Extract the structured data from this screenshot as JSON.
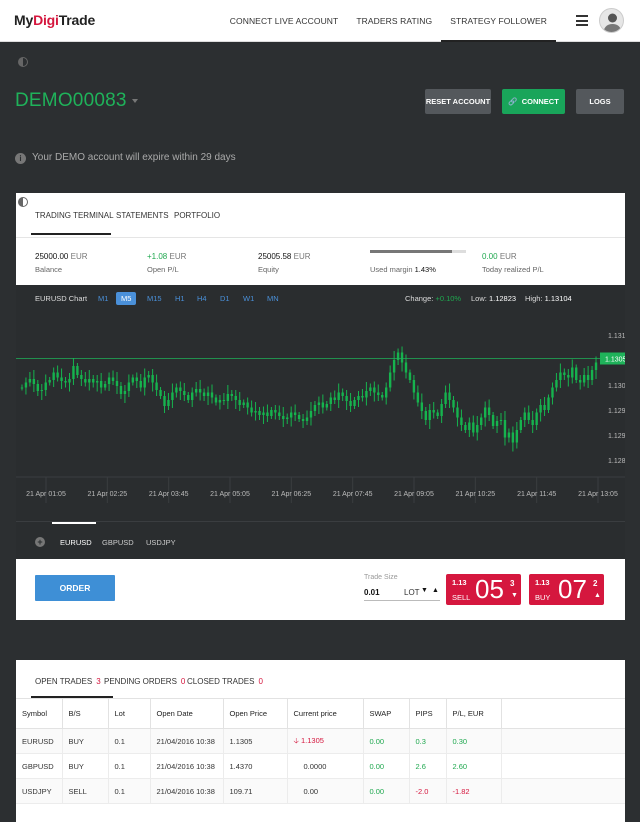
{
  "brand": {
    "logo_pre": "My",
    "logo_mid": "Digi",
    "logo_post": "Trade"
  },
  "nav": {
    "items": [
      "CONNECT LIVE ACCOUNT",
      "TRADERS RATING",
      "STRATEGY FOLLOWER"
    ],
    "active": "STRATEGY FOLLOWER"
  },
  "account": {
    "name": "DEMO00083",
    "expiry_notice": "Your DEMO account will expire within 29 days"
  },
  "actions": {
    "reset": "RESET ACCOUNT",
    "connect": "CONNECT",
    "logs": "LOGS"
  },
  "terminal_tabs": [
    "TRADING TERMINAL",
    "STATEMENTS",
    "PORTFOLIO"
  ],
  "stats": {
    "balance": {
      "value": "25000.00",
      "unit": "EUR",
      "label": "Balance"
    },
    "open_pl": {
      "value": "+1.08",
      "unit": "EUR",
      "label": "Open P/L"
    },
    "equity": {
      "value": "25005.58",
      "unit": "EUR",
      "label": "Equity"
    },
    "used_margin": {
      "label": "Used margin",
      "value": "1.43%",
      "fill": 0.85
    },
    "today_pl": {
      "value": "0.00",
      "unit": "EUR",
      "label": "Today realized P/L"
    }
  },
  "chart_header": {
    "title": "EURUSD Chart",
    "timeframes": [
      "M1",
      "M5",
      "M15",
      "H1",
      "H4",
      "D1",
      "W1",
      "MN"
    ],
    "active_timeframe": "M5",
    "change_label": "Change:",
    "change_value": "+0.10%",
    "low_label": "Low:",
    "low_value": "1.12823",
    "high_label": "High:",
    "high_value": "1.13104"
  },
  "chart_data": {
    "type": "candlestick",
    "symbol": "EURUSD",
    "y_ticks": [
      1.131,
      1.1305,
      1.13,
      1.1295,
      1.129,
      1.1285
    ],
    "y_tick_labels": [
      "1.13100",
      "1.13050",
      "1.13000",
      "1.12950",
      "1.12900",
      "1.12850"
    ],
    "ylim": [
      1.1281,
      1.1312
    ],
    "x_tick_labels": [
      "21 Apr 01:05",
      "21 Apr 02:25",
      "21 Apr 03:45",
      "21 Apr 05:05",
      "21 Apr 06:25",
      "21 Apr 07:45",
      "21 Apr 09:05",
      "21 Apr 10:25",
      "21 Apr 11:45",
      "21 Apr 13:05"
    ],
    "current_price": 1.13053,
    "current_price_label": "1.13053",
    "candles_close": [
      1.12995,
      1.13005,
      1.13012,
      1.13002,
      1.12988,
      1.1299,
      1.13005,
      1.1301,
      1.13025,
      1.13015,
      1.13008,
      1.13005,
      1.13012,
      1.13038,
      1.1302,
      1.13012,
      1.13005,
      1.13012,
      1.13005,
      1.13008,
      1.12995,
      1.13002,
      1.13015,
      1.13008,
      1.12998,
      1.12982,
      1.12988,
      1.13005,
      1.13015,
      1.13008,
      1.12995,
      1.13015,
      1.1302,
      1.13005,
      1.1299,
      1.12978,
      1.12958,
      1.1297,
      1.12985,
      1.12995,
      1.12988,
      1.1298,
      1.1297,
      1.12985,
      1.12992,
      1.12985,
      1.12978,
      1.12985,
      1.12975,
      1.12965,
      1.1297,
      1.12968,
      1.12982,
      1.12978,
      1.1297,
      1.1296,
      1.12965,
      1.12955,
      1.12945,
      1.12948,
      1.1294,
      1.12945,
      1.12938,
      1.1295,
      1.12945,
      1.12938,
      1.12932,
      1.12935,
      1.12945,
      1.1294,
      1.12932,
      1.12928,
      1.12935,
      1.12948,
      1.1296,
      1.12965,
      1.12955,
      1.12962,
      1.12975,
      1.1297,
      1.12985,
      1.12978,
      1.12968,
      1.12958,
      1.1297,
      1.12978,
      1.12975,
      1.12988,
      1.12995,
      1.12985,
      1.1298,
      1.12975,
      1.12995,
      1.13025,
      1.1305,
      1.13065,
      1.13045,
      1.13025,
      1.1301,
      1.12985,
      1.12965,
      1.12948,
      1.1293,
      1.1295,
      1.12945,
      1.12938,
      1.12962,
      1.12985,
      1.1297,
      1.12955,
      1.12935,
      1.1292,
      1.1291,
      1.12925,
      1.12905,
      1.1292,
      1.12935,
      1.12955,
      1.1294,
      1.12918,
      1.12928,
      1.1293,
      1.12895,
      1.12905,
      1.12885,
      1.1291,
      1.1293,
      1.12945,
      1.1293,
      1.1292,
      1.12945,
      1.1296,
      1.1295,
      1.12975,
      1.12995,
      1.1301,
      1.13025,
      1.1302,
      1.13015,
      1.13035,
      1.1301,
      1.13005,
      1.1302,
      1.1301,
      1.1303,
      1.13045
    ]
  },
  "pairs": [
    "EURUSD",
    "GBPUSD",
    "USDJPY"
  ],
  "active_pair": "EURUSD",
  "order": {
    "button": "ORDER",
    "trade_size_label": "Trade Size",
    "trade_size_value": "0.01",
    "unit": "LOT",
    "sell": {
      "prefix": "1.13",
      "label": "SELL",
      "big": "05",
      "sup": "3"
    },
    "buy": {
      "prefix": "1.13",
      "label": "BUY",
      "big": "07",
      "sup": "2"
    }
  },
  "trade_tabs": [
    {
      "label": "OPEN TRADES",
      "count": "3"
    },
    {
      "label": "PENDING ORDERS",
      "count": "0"
    },
    {
      "label": "CLOSED TRADES",
      "count": "0"
    }
  ],
  "table": {
    "headers": [
      "Symbol",
      "B/S",
      "Lot",
      "Open Date",
      "Open Price",
      "Current price",
      "SWAP",
      "PIPS",
      "P/L, EUR"
    ],
    "rows": [
      [
        "EURUSD",
        "BUY",
        "0.1",
        "21/04/2016 10:38",
        "1.1305",
        "1.1305",
        "0.00",
        "0.3",
        "0.30"
      ],
      [
        "GBPUSD",
        "BUY",
        "0.1",
        "21/04/2016 10:38",
        "1.4370",
        "0.0000",
        "0.00",
        "2.6",
        "2.60"
      ],
      [
        "USDJPY",
        "SELL",
        "0.1",
        "21/04/2016 10:38",
        "109.71",
        "0.00",
        "0.00",
        "-2.0",
        "-1.82"
      ]
    ]
  },
  "colors": {
    "green": "#1fb25a",
    "red": "#d5173e",
    "blue": "#3e8fd6",
    "dark_bg": "#2c2f31"
  }
}
